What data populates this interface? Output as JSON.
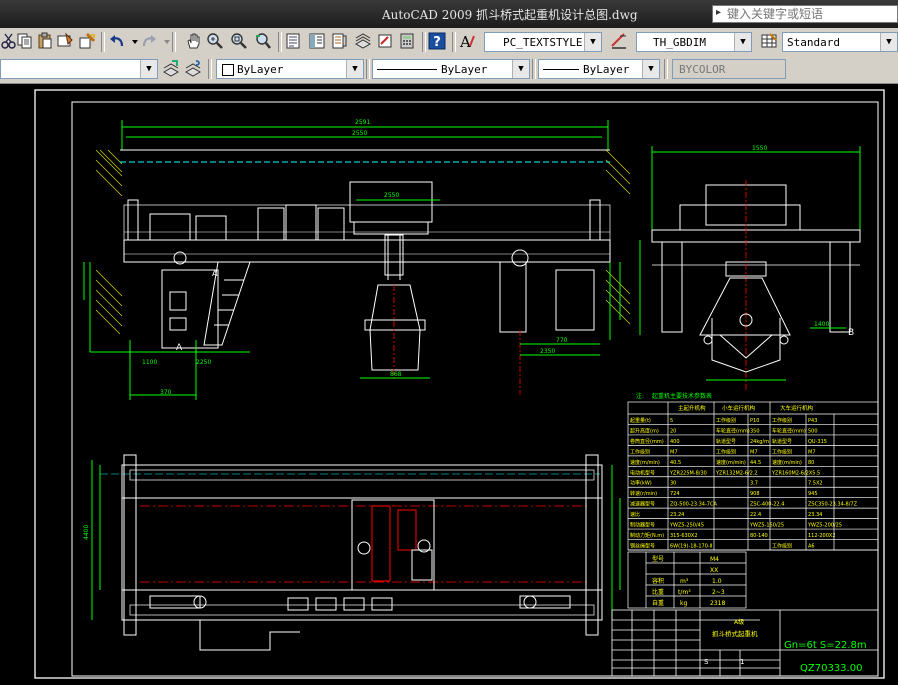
{
  "window": {
    "title": "AutoCAD 2009  抓斗桥式起重机设计总图.dwg",
    "search_placeholder": "键入关键字或短语"
  },
  "toolbar_row1": {
    "text_style": "PC_TEXTSTYLE",
    "dim_style": "TH_GBDIM",
    "table_style": "Standard",
    "icons": [
      "copy-icon",
      "paste-icon",
      "match-properties-icon",
      "block-editor-icon",
      "undo-icon",
      "redo-icon",
      "pan-icon",
      "zoom-realtime-icon",
      "zoom-window-icon",
      "zoom-previous-icon",
      "properties-icon",
      "design-center-icon",
      "tool-palettes-icon",
      "sheet-set-icon",
      "markup-icon",
      "quickcalc-icon",
      "help-icon",
      "text-style-icon",
      "dim-style-icon",
      "table-style-icon"
    ]
  },
  "toolbar_row2": {
    "color": "ByLayer",
    "linetype": "ByLayer",
    "lineweight": "ByLayer",
    "plot_style": "BYCOLOR"
  },
  "drawing": {
    "dimensions": {
      "top_span": "2591",
      "top_inner": "2550",
      "trolley_span": "2550",
      "left_bottom_a": "1100",
      "left_bottom_b": "2250",
      "left_bottom_c": "370",
      "right_bottom_a": "770",
      "right_bottom_b": "2350",
      "mid_bottom": "868",
      "side_width": "1550",
      "side_base": "1400",
      "plan_height": "4400",
      "plan_height2": "5050"
    },
    "section_marks": [
      "A",
      "A",
      "B"
    ],
    "spec_table": {
      "title": "起重机主要技术参数表",
      "note_label": "注:",
      "headers": [
        "主起升机构",
        "小车运行机构",
        "大车运行机构"
      ],
      "rows": [
        [
          "起重量(t)",
          "5",
          "工作级别",
          "P10",
          "工作级别",
          "P43"
        ],
        [
          "起升高度(m)",
          "20",
          "车轮直径(mm)",
          "350",
          "车轮直径(mm)",
          "500"
        ],
        [
          "卷筒直径(mm)",
          "400",
          "轨道型号",
          "24kg/m",
          "轨道型号",
          "QU-315"
        ],
        [
          "工作级别",
          "M7",
          "工作级别",
          "M7",
          "工作级别",
          "M7"
        ],
        [
          "速度(m/min)",
          "40.5",
          "速度(m/min)",
          "44.5",
          "速度(m/min)",
          "80"
        ],
        [
          "电动机型号",
          "YZR225M-8/30",
          "YZR132M2-6/2.2",
          "",
          "YZR160M2-6/2X5.5",
          ""
        ],
        [
          "功率(kW)",
          "30",
          "",
          "3.7",
          "",
          "7.5X2"
        ],
        [
          "转速(r/min)",
          "724",
          "",
          "908",
          "",
          "945"
        ],
        [
          "减速器型号",
          "ZQ-500-23.34-7CA",
          "",
          "ZSC-400-22.4",
          "",
          "ZSC350-23.34-8/7Z"
        ],
        [
          "速比",
          "23.24",
          "",
          "22.4",
          "",
          "23.34"
        ],
        [
          "制动器型号",
          "YWZ5-250/45",
          "",
          "YWZ5-150/25",
          "",
          "YWZ5-200/25"
        ],
        [
          "制动力矩(N.m)",
          "315-630X2",
          "",
          "80-140",
          "",
          "112-200X2"
        ],
        [
          "钢丝绳型号",
          "6W(19)-18-170-Ⅱ",
          "",
          "",
          "工作级别",
          "A6"
        ]
      ]
    },
    "grab_table": {
      "rows": [
        [
          "型号",
          "M4"
        ],
        [
          "",
          "XX"
        ],
        [
          "容积",
          "m³",
          "1.0"
        ],
        [
          "比重",
          "t/m³",
          "2~3"
        ],
        [
          "自重",
          "kg",
          "2318"
        ]
      ]
    },
    "title_block": {
      "name_line1": "A级",
      "name_line2": "抓斗桥式起重机",
      "spec": "Gn=6t  S=22.8m",
      "drawing_no": "QZ70333.00",
      "scale_row": [
        "S",
        "1"
      ]
    }
  }
}
